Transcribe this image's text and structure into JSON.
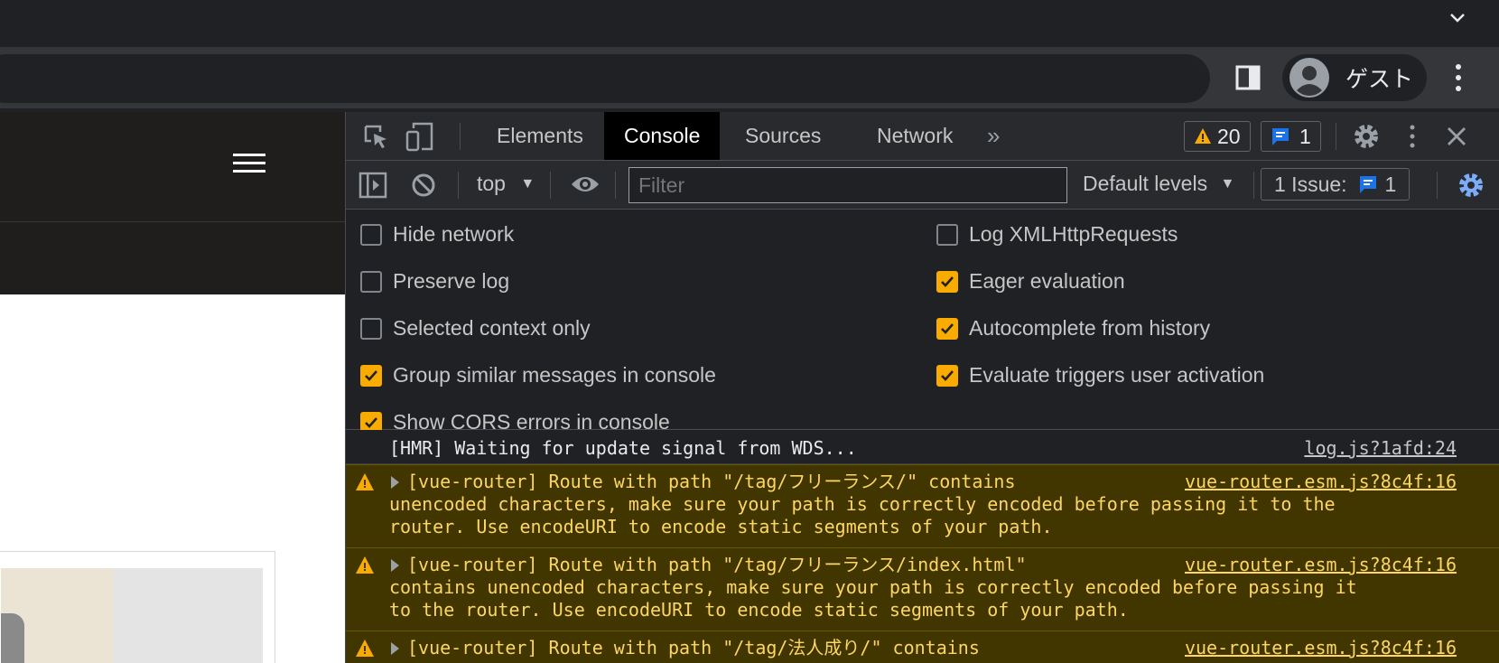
{
  "browser": {
    "profile_name": "ゲスト",
    "icons": [
      "chevron-down-icon",
      "side-panel-icon",
      "avatar-icon",
      "kebab-menu-icon"
    ]
  },
  "devtools": {
    "tabs": [
      {
        "label": "Elements",
        "active": false
      },
      {
        "label": "Console",
        "active": true
      },
      {
        "label": "Sources",
        "active": false
      },
      {
        "label": "Network",
        "active": false
      }
    ],
    "more_tabs": "»",
    "warnings_count": "20",
    "messages_count": "1",
    "context": "top",
    "filter_placeholder": "Filter",
    "levels": "Default levels",
    "issues_label": "1 Issue:",
    "issues_count": "1",
    "settings": {
      "left": [
        {
          "label": "Hide network",
          "checked": false
        },
        {
          "label": "Preserve log",
          "checked": false
        },
        {
          "label": "Selected context only",
          "checked": false
        },
        {
          "label": "Group similar messages in console",
          "checked": true
        },
        {
          "label": "Show CORS errors in console",
          "checked": true
        }
      ],
      "right": [
        {
          "label": "Log XMLHttpRequests",
          "checked": false
        },
        {
          "label": "Eager evaluation",
          "checked": true
        },
        {
          "label": "Autocomplete from history",
          "checked": true
        },
        {
          "label": "Evaluate triggers user activation",
          "checked": true
        }
      ]
    },
    "messages": [
      {
        "type": "info",
        "text": "[HMR] Waiting for update signal from WDS...",
        "source": "log.js?1afd:24"
      },
      {
        "type": "warn",
        "lines": [
          "[vue-router] Route with path \"/tag/フリーランス/\" contains",
          "unencoded characters, make sure your path is correctly encoded before passing it to the",
          "router. Use encodeURI to encode static segments of your path."
        ],
        "source": "vue-router.esm.js?8c4f:16"
      },
      {
        "type": "warn",
        "lines": [
          "[vue-router] Route with path \"/tag/フリーランス/index.html\"",
          "contains unencoded characters, make sure your path is correctly encoded before passing it",
          "to the router. Use encodeURI to encode static segments of your path."
        ],
        "source": "vue-router.esm.js?8c4f:16"
      },
      {
        "type": "warn",
        "lines": [
          "[vue-router] Route with path \"/tag/法人成り/\" contains"
        ],
        "source": "vue-router.esm.js?8c4f:16"
      }
    ]
  },
  "colors": {
    "warning": "#f9ab00",
    "warning_bg": "#413500",
    "warning_text": "#fdd663",
    "accent_blue": "#1a73e8",
    "settings_gear": "#7cacf8"
  }
}
